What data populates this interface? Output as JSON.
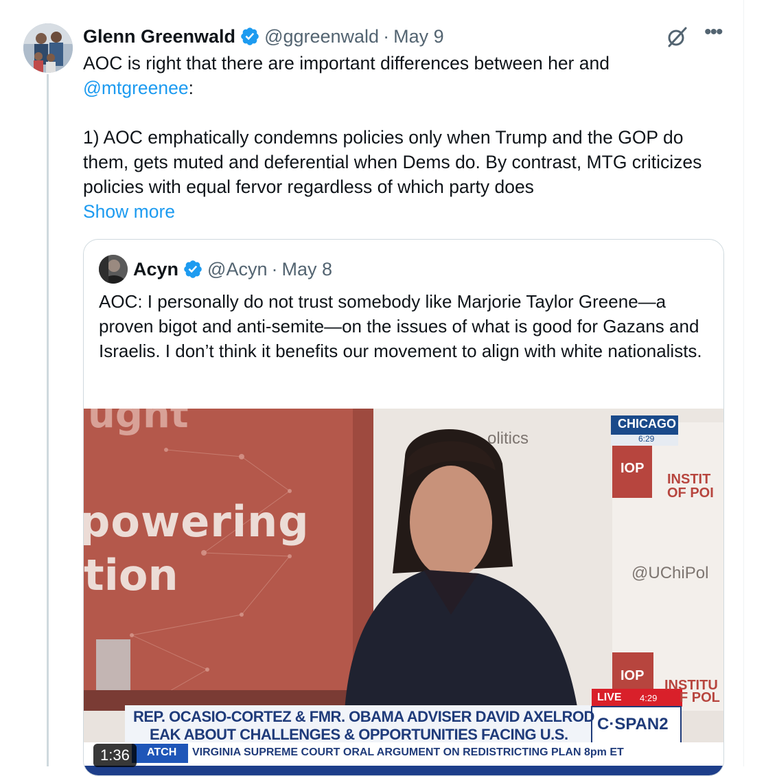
{
  "tweet": {
    "author_name": "Glenn Greenwald",
    "handle": "@ggreenwald",
    "separator": "·",
    "date": "May 9",
    "text_line1": "AOC is right that there are important differences between her and ",
    "mention": "@mtgreenee",
    "mention_suffix": ":",
    "text_para2": "1) AOC emphatically condemns policies only when Trump and the GOP do them, gets muted and deferential when Dems do. By contrast, MTG criticizes policies with equal fervor regardless of which party does",
    "show_more": "Show more",
    "more_icon": "•••"
  },
  "quote": {
    "author_name": "Acyn",
    "handle": "@Acyn",
    "separator": "·",
    "date": "May 8",
    "text": "AOC: I personally do not trust somebody like Marjorie Taylor Greene—a proven bigot and anti-semite—on the issues of  what is good for Gazans and Israelis. I don’t think it benefits our movement to align with white nationalists.",
    "video": {
      "duration": "1:36",
      "bg_text_1": "ught",
      "bg_text_2": "powering",
      "bg_text_3": "tion",
      "bg_politics": "olitics",
      "bg_handle": "@UChiPol",
      "bg_iop": "IOP",
      "bg_institute_1": "INSTIT",
      "bg_institute_2": "OF POI",
      "bg_institute_3": "INSTITU",
      "bg_institute_4": "F POL",
      "network_city": "CHICAGO",
      "network_city_time": "6:29",
      "live_label": "LIVE",
      "live_time": "4:29",
      "chyron_line1": "REP. OCASIO-CORTEZ & FMR. OBAMA ADVISER DAVID AXELROD",
      "chyron_line2": "EAK ABOUT CHALLENGES & OPPORTUNITIES FACING U.S.",
      "network_logo": "C·SPAN2",
      "ticker_label": "ATCH",
      "ticker_text": "VIRGINIA SUPREME COURT ORAL ARGUMENT ON REDISTRICTING PLAN  8pm ET"
    }
  },
  "colors": {
    "accent": "#1d9bf0",
    "text_primary": "#0f1419",
    "text_secondary": "#536471",
    "border": "#cfd9de"
  }
}
